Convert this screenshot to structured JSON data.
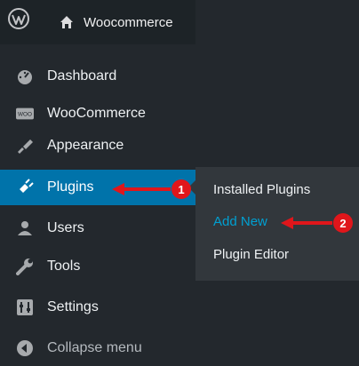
{
  "topbar": {
    "site_name": "Woocommerce"
  },
  "menu": {
    "items": [
      {
        "label": "Dashboard",
        "icon": "dashboard-icon"
      },
      {
        "label": "WooCommerce",
        "icon": "woocommerce-icon"
      },
      {
        "label": "Appearance",
        "icon": "appearance-icon"
      },
      {
        "label": "Plugins",
        "icon": "plugins-icon",
        "active": true
      },
      {
        "label": "Users",
        "icon": "users-icon"
      },
      {
        "label": "Tools",
        "icon": "tools-icon"
      },
      {
        "label": "Settings",
        "icon": "settings-icon"
      },
      {
        "label": "Collapse menu",
        "icon": "collapse-icon"
      }
    ]
  },
  "submenu": {
    "items": [
      {
        "label": "Installed Plugins"
      },
      {
        "label": "Add New",
        "current": true
      },
      {
        "label": "Plugin Editor"
      }
    ]
  },
  "annotations": {
    "step1": "1",
    "step2": "2",
    "arrow_color": "#e0161b"
  },
  "colors": {
    "active_bg": "#0073aa",
    "sidebar_bg": "#23282d",
    "submenu_bg": "#32373c",
    "link_accent": "#00a0d2"
  }
}
